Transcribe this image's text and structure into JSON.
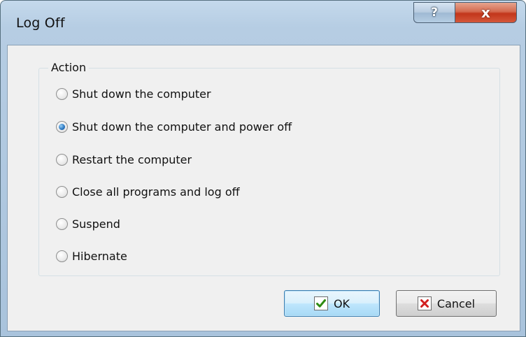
{
  "window": {
    "title": "Log Off",
    "help_glyph": "?",
    "close_glyph": "x"
  },
  "action_group": {
    "label": "Action",
    "options": [
      {
        "label": "Shut down the computer",
        "selected": false
      },
      {
        "label": "Shut down the computer and power off",
        "selected": true
      },
      {
        "label": "Restart the computer",
        "selected": false
      },
      {
        "label": "Close all programs and log off",
        "selected": false
      },
      {
        "label": "Suspend",
        "selected": false
      },
      {
        "label": "Hibernate",
        "selected": false
      }
    ]
  },
  "buttons": {
    "ok_label": "OK",
    "ok_icon": "green-checkmark-icon",
    "cancel_label": "Cancel",
    "cancel_icon": "red-x-icon"
  },
  "colors": {
    "checkmark": "#2e8b12",
    "cancel_x": "#d21f1f",
    "selected_radio": "#2f7bc4"
  }
}
